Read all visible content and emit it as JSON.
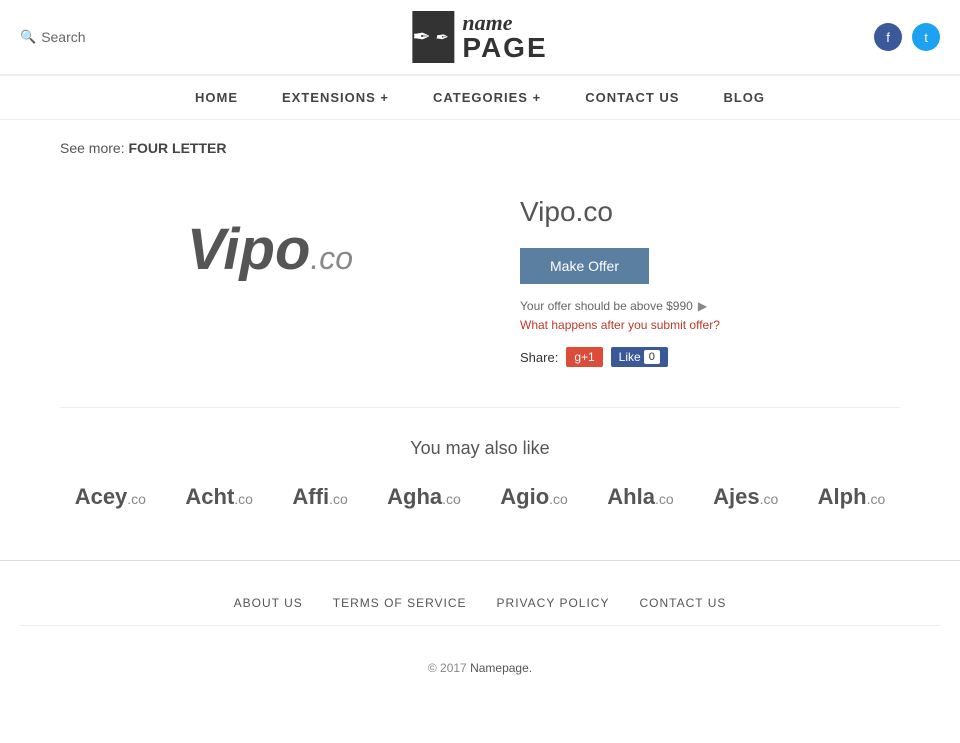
{
  "header": {
    "search_label": "Search",
    "logo_name": "name",
    "logo_page": "PAGE",
    "social": {
      "facebook_icon": "f",
      "twitter_icon": "t"
    }
  },
  "nav": {
    "items": [
      {
        "label": "HOME",
        "has_dropdown": false
      },
      {
        "label": "EXTENSIONS +",
        "has_dropdown": true
      },
      {
        "label": "CATEGORIES +",
        "has_dropdown": true
      },
      {
        "label": "CONTACT US",
        "has_dropdown": false
      },
      {
        "label": "BLOG",
        "has_dropdown": false
      }
    ]
  },
  "breadcrumb": {
    "prefix": "See more:",
    "link_label": "FOUR LETTER"
  },
  "domain_showcase": {
    "name": "Vipo",
    "tld": ".co",
    "full_name": "Vipo.co",
    "make_offer_label": "Make Offer",
    "offer_note": "Your offer should be above $990",
    "offer_amount": "$990",
    "what_happens_label": "What happens after you submit offer?",
    "share_label": "Share:",
    "gplus_label": "g+1",
    "fb_like_label": "Like",
    "fb_count": "0"
  },
  "also_like": {
    "title": "You may also like",
    "domains": [
      {
        "name": "Acey",
        "tld": ".co"
      },
      {
        "name": "Acht",
        "tld": ".co"
      },
      {
        "name": "Affi",
        "tld": ".co"
      },
      {
        "name": "Agha",
        "tld": ".co"
      },
      {
        "name": "Agio",
        "tld": ".co"
      },
      {
        "name": "Ahla",
        "tld": ".co"
      },
      {
        "name": "Ajes",
        "tld": ".co"
      },
      {
        "name": "Alph",
        "tld": ".co"
      }
    ]
  },
  "footer": {
    "links": [
      {
        "label": "ABOUT US"
      },
      {
        "label": "TERMS OF SERVICE"
      },
      {
        "label": "PRIVACY POLICY"
      },
      {
        "label": "CONTACT US"
      }
    ],
    "copyright": "© 2017",
    "brand": "Namepage."
  }
}
